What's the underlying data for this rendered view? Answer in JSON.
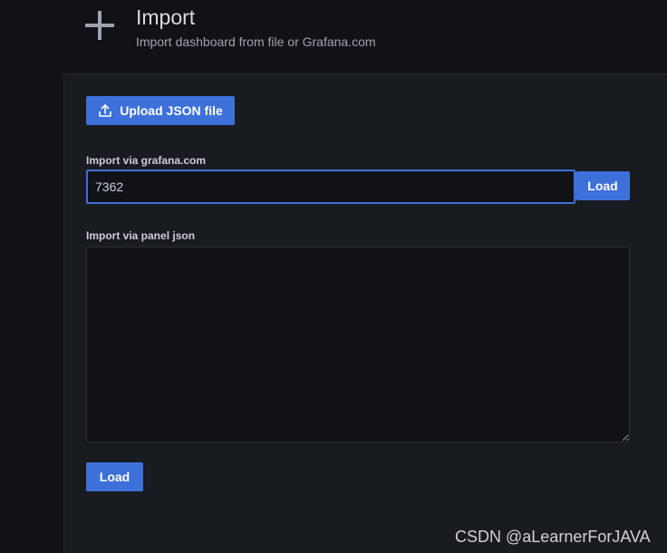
{
  "header": {
    "title": "Import",
    "subtitle": "Import dashboard from file or Grafana.com",
    "icon": "plus-icon"
  },
  "upload": {
    "label": "Upload JSON file",
    "icon": "upload-icon"
  },
  "grafana_import": {
    "label": "Import via grafana.com",
    "value": "7362",
    "button_label": "Load"
  },
  "panel_json": {
    "label": "Import via panel json",
    "value": ""
  },
  "footer": {
    "load_label": "Load"
  },
  "watermark": "CSDN @aLearnerForJAVA",
  "colors": {
    "background": "#111217",
    "panel": "#181b1f",
    "primary": "#3d71d9"
  }
}
